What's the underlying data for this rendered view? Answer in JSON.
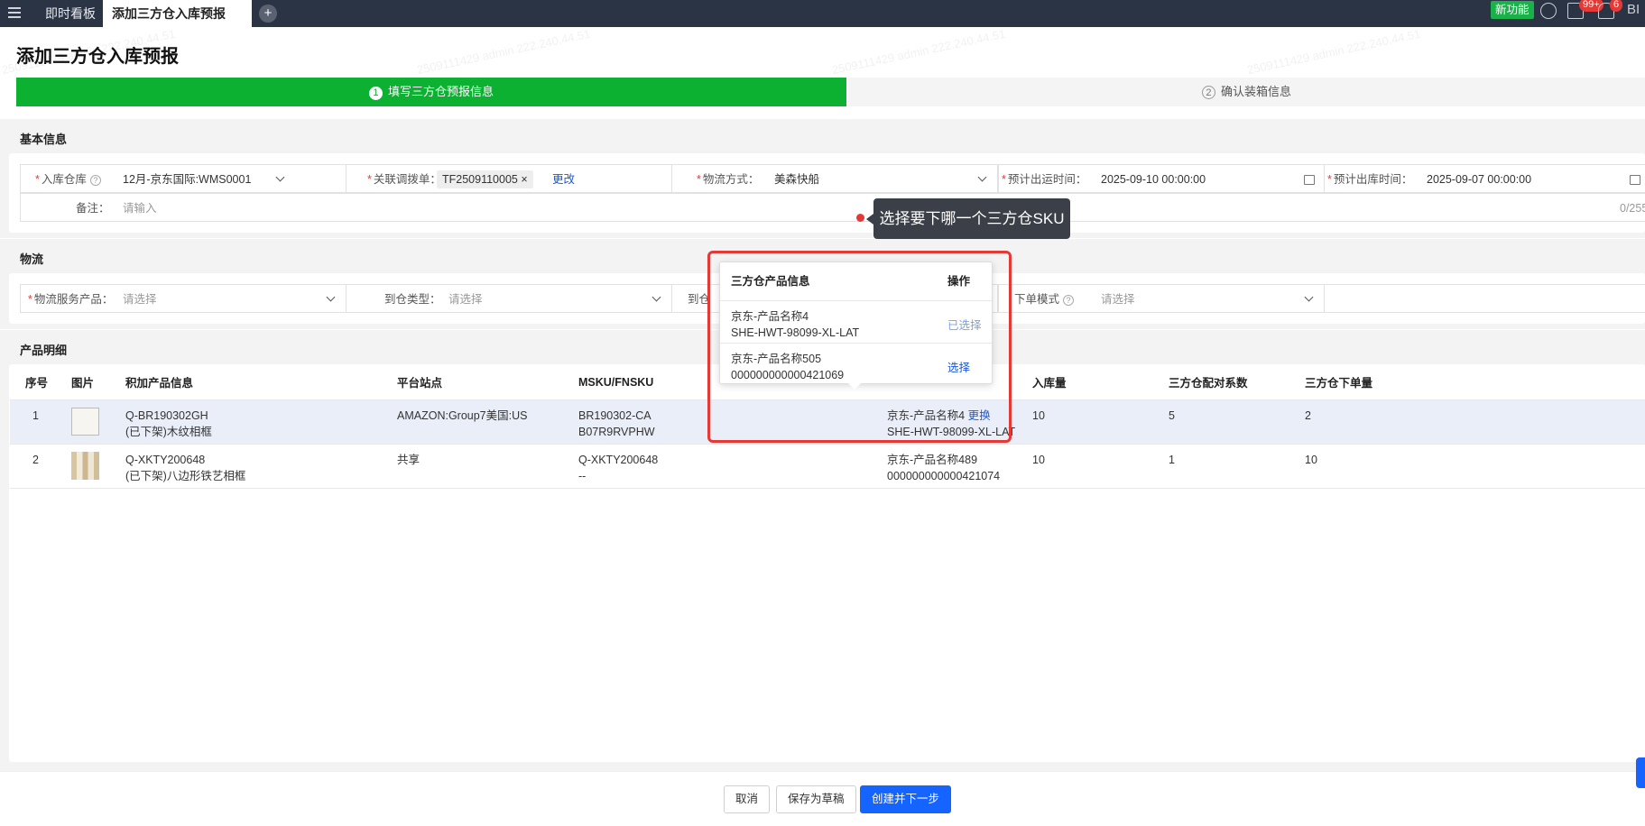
{
  "topbar": {
    "tabs": [
      {
        "label": "即时看板"
      },
      {
        "label": "添加三方仓入库预报"
      }
    ],
    "add_symbol": "+",
    "new_feature": "新功能",
    "badges": {
      "tasks": "99+",
      "notifications": "6"
    },
    "user_initials": "BI",
    "icons": [
      "menu-icon",
      "help-icon",
      "task-icon",
      "bell-icon"
    ]
  },
  "page": {
    "title": "添加三方仓入库预报"
  },
  "steps": [
    {
      "num": "1",
      "label": "填写三方仓预报信息",
      "active": true
    },
    {
      "num": "2",
      "label": "确认装箱信息",
      "active": false
    }
  ],
  "basic": {
    "section_title": "基本信息",
    "warehouse": {
      "label": "入库仓库",
      "value": "12月-京东国际:WMS0001"
    },
    "transfer": {
      "label": "关联调拨单：",
      "tag": "TF2509110005",
      "remove": "×",
      "change": "更改"
    },
    "shipping": {
      "label": "物流方式：",
      "value": "美森快船"
    },
    "ship_time": {
      "label": "预计出运时间：",
      "value": "2025-09-10 00:00:00"
    },
    "out_time": {
      "label": "预计出库时间：",
      "value": "2025-09-07 00:00:00"
    },
    "remark": {
      "label": "备注：",
      "placeholder": "请输入",
      "counter": "0/255"
    }
  },
  "logistics": {
    "section_title": "物流",
    "service": {
      "label": "物流服务产品：",
      "placeholder": "请选择"
    },
    "arrival_type": {
      "label": "到仓类型：",
      "placeholder": "请选择"
    },
    "arrival_partial": {
      "label": "到仓"
    },
    "order_mode": {
      "label": "下单模式",
      "placeholder": "请选择"
    }
  },
  "products": {
    "section_title": "产品明细",
    "columns": [
      "序号",
      "图片",
      "积加产品信息",
      "平台站点",
      "MSKU/FNSKU",
      "",
      "入库量",
      "三方仓配对系数",
      "三方仓下单量"
    ],
    "rows": [
      {
        "no": "1",
        "sku": "Q-BR190302GH",
        "name": "(已下架)木纹相框",
        "site": "AMAZON:Group7美国:US",
        "msku": "BR190302-CA",
        "fnsku": "B07R9RVPHW",
        "tp_name": "京东-产品名称4",
        "tp_action": "更换",
        "tp_code": "SHE-HWT-98099-XL-LAT",
        "qty": "10",
        "ratio": "5",
        "order_qty": "2"
      },
      {
        "no": "2",
        "sku": "Q-XKTY200648",
        "name": "(已下架)八边形铁艺相框",
        "site": "共享",
        "msku": "Q-XKTY200648",
        "fnsku": "--",
        "tp_name": "京东-产品名称489",
        "tp_action": "",
        "tp_code": "000000000000421074",
        "qty": "10",
        "ratio": "1",
        "order_qty": "10"
      }
    ]
  },
  "popover": {
    "header_info": "三方仓产品信息",
    "header_action": "操作",
    "items": [
      {
        "name": "京东-产品名称4",
        "code": "SHE-HWT-98099-XL-LAT",
        "action": "已选择"
      },
      {
        "name": "京东-产品名称505",
        "code": "000000000000421069",
        "action": "选择"
      }
    ]
  },
  "tooltip": {
    "text": "选择要下哪一个三方仓SKU"
  },
  "footer": {
    "cancel": "取消",
    "save_draft": "保存为草稿",
    "create_next": "创建并下一步"
  },
  "watermark": "2509111429 admin 222.240.44.51",
  "colors": {
    "accent_green": "#0cb131",
    "primary_blue": "#1664ff",
    "highlight_red": "#e53935",
    "topbar": "#2b3445"
  }
}
